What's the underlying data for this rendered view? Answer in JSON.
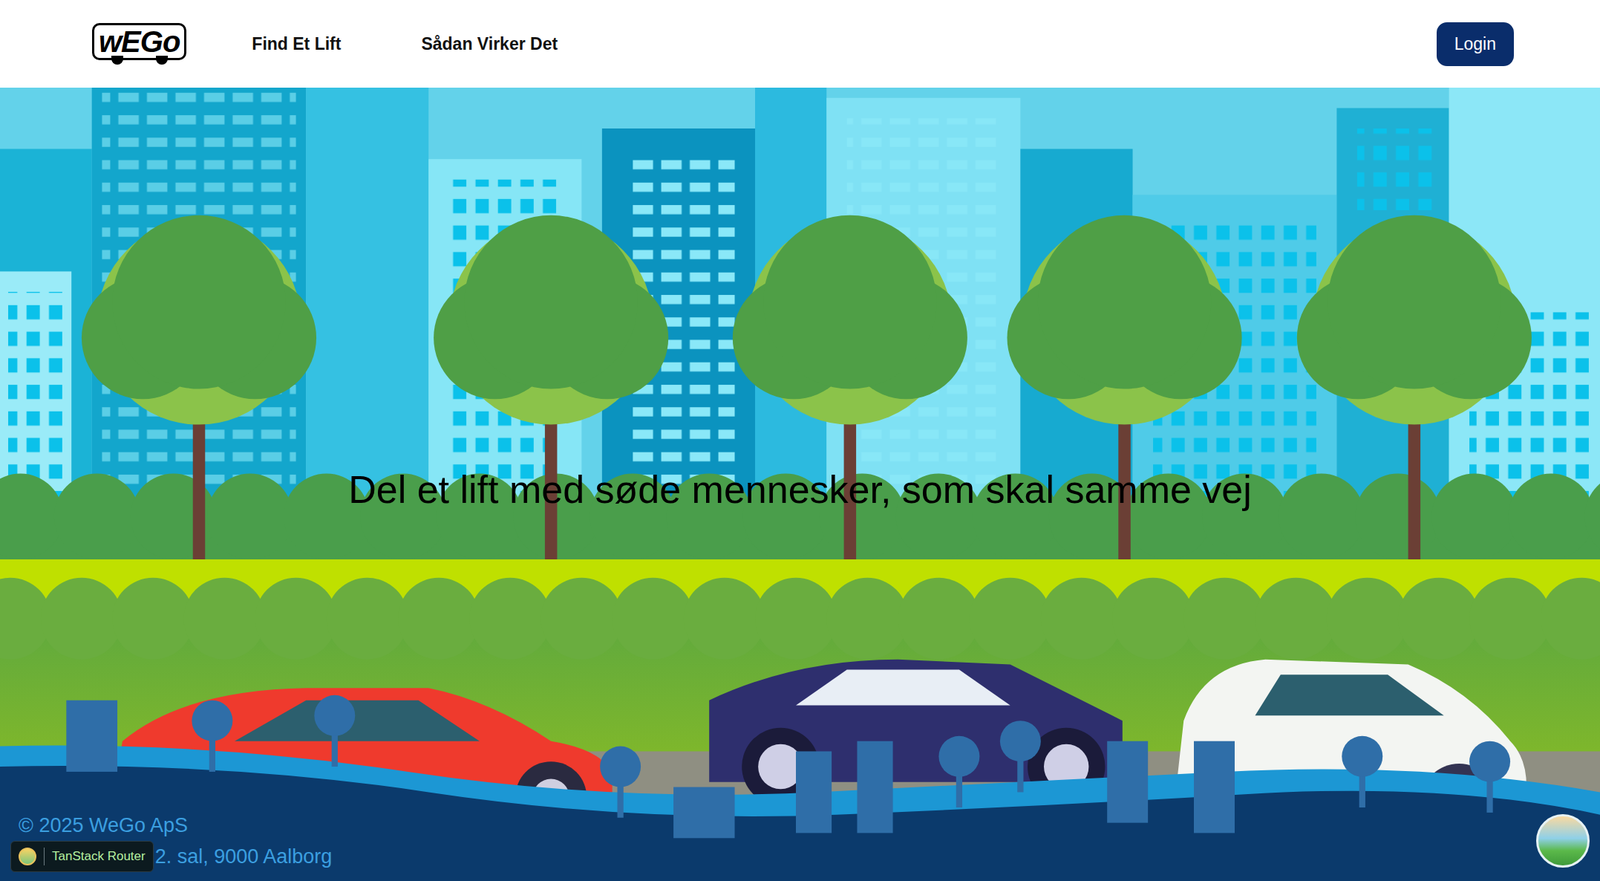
{
  "header": {
    "logo": "wEGo",
    "nav": [
      {
        "label": "Find Et Lift"
      },
      {
        "label": "Sådan Virker Det"
      }
    ],
    "login": "Login"
  },
  "hero": {
    "tagline": "Del et lift med søde mennesker, som skal samme vej"
  },
  "footer": {
    "copyright": "© 2025 WeGo ApS",
    "address": "2. sal, 9000 Aalborg"
  },
  "devtools": {
    "label": "TanStack Router"
  }
}
